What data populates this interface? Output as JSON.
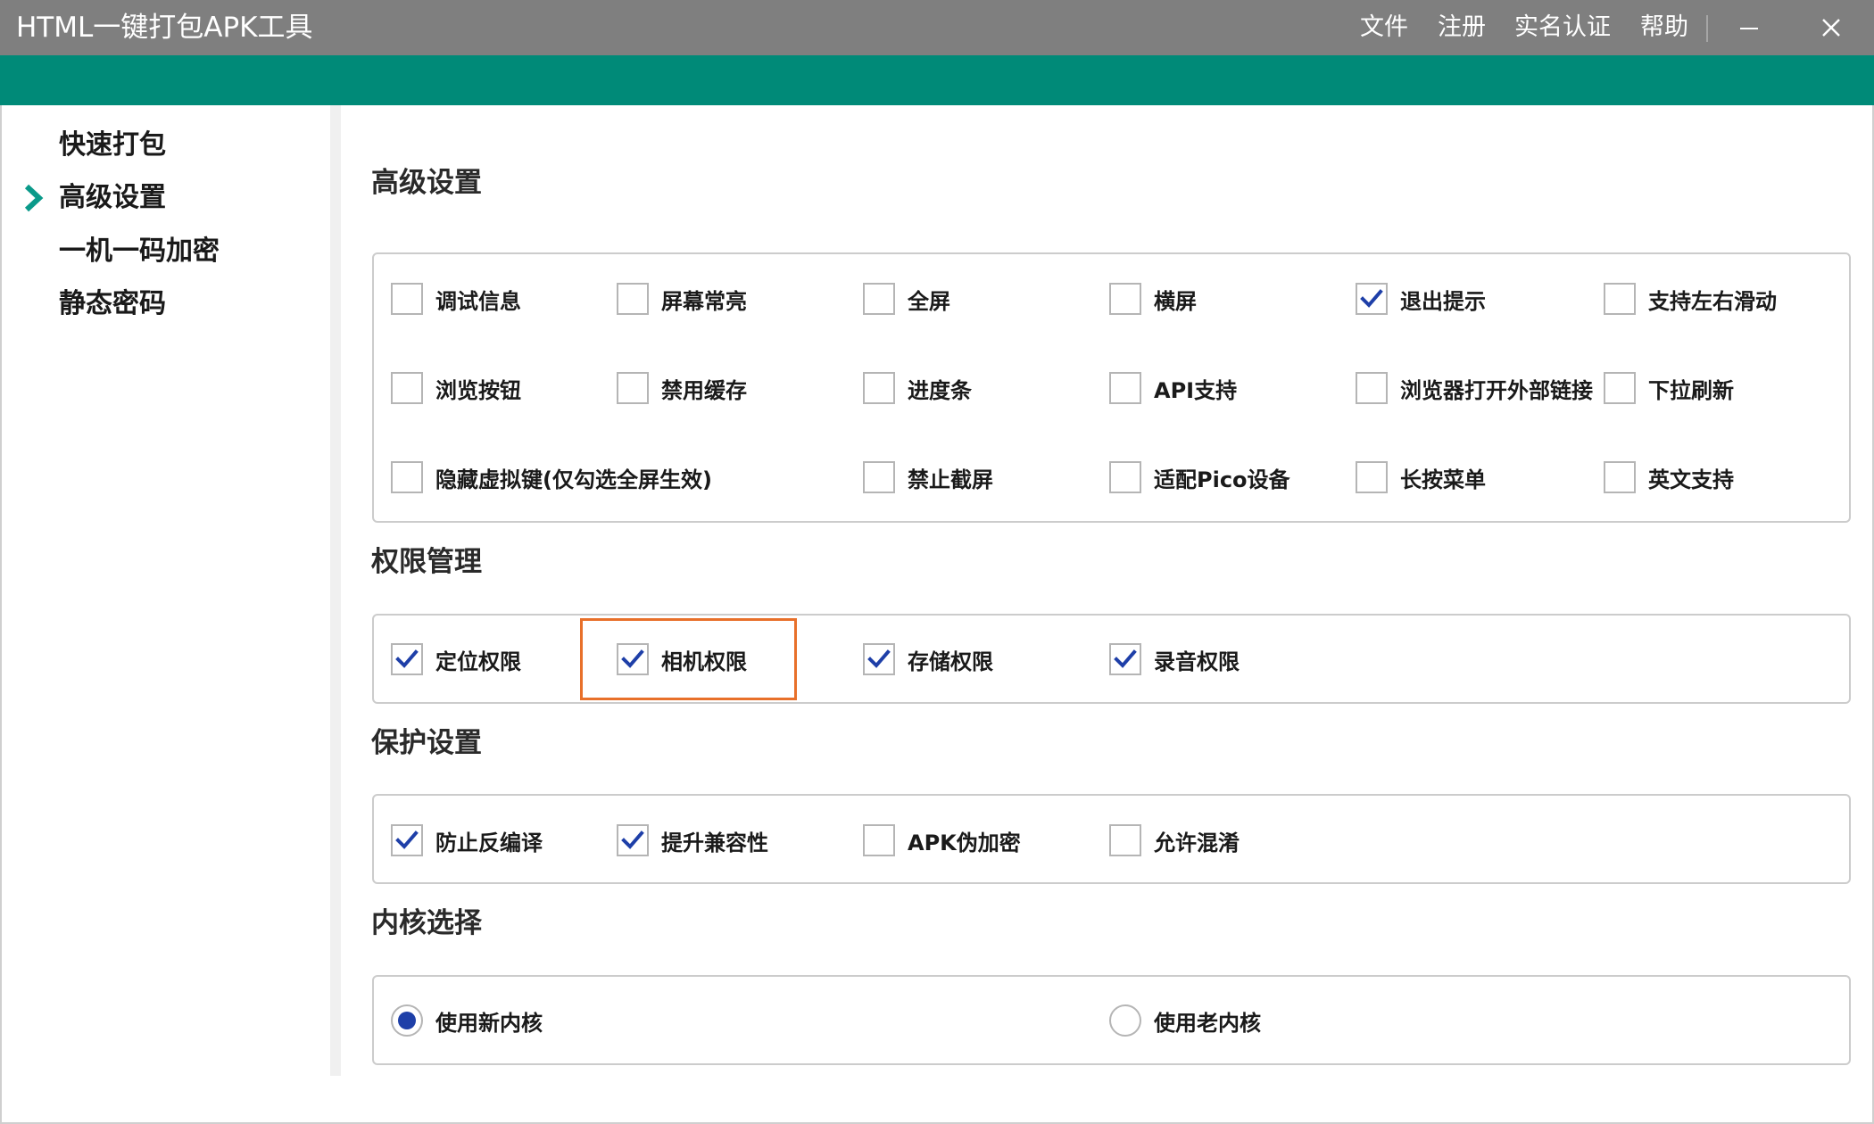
{
  "window": {
    "title": "HTML一键打包APK工具",
    "menu": [
      "文件",
      "注册",
      "实名认证",
      "帮助"
    ]
  },
  "sidebar": {
    "items": [
      {
        "label": "快速打包",
        "active": false
      },
      {
        "label": "高级设置",
        "active": true
      },
      {
        "label": "一机一码加密",
        "active": false
      },
      {
        "label": "静态密码",
        "active": false
      }
    ]
  },
  "advanced": {
    "title": "高级设置",
    "options": [
      {
        "label": "调试信息",
        "checked": false
      },
      {
        "label": "屏幕常亮",
        "checked": false
      },
      {
        "label": "全屏",
        "checked": false
      },
      {
        "label": "横屏",
        "checked": false
      },
      {
        "label": "退出提示",
        "checked": true
      },
      {
        "label": "支持左右滑动",
        "checked": false
      },
      {
        "label": "浏览按钮",
        "checked": false
      },
      {
        "label": "禁用缓存",
        "checked": false
      },
      {
        "label": "进度条",
        "checked": false
      },
      {
        "label": "API支持",
        "checked": false
      },
      {
        "label": "浏览器打开外部链接",
        "checked": false
      },
      {
        "label": "下拉刷新",
        "checked": false
      },
      {
        "label": "隐藏虚拟键(仅勾选全屏生效)",
        "checked": false
      },
      {
        "label": "禁止截屏",
        "checked": false
      },
      {
        "label": "适配Pico设备",
        "checked": false
      },
      {
        "label": "长按菜单",
        "checked": false
      },
      {
        "label": "英文支持",
        "checked": false
      }
    ]
  },
  "permissions": {
    "title": "权限管理",
    "options": [
      {
        "label": "定位权限",
        "checked": true
      },
      {
        "label": "相机权限",
        "checked": true
      },
      {
        "label": "存储权限",
        "checked": true
      },
      {
        "label": "录音权限",
        "checked": true
      }
    ]
  },
  "protection": {
    "title": "保护设置",
    "options": [
      {
        "label": "防止反编译",
        "checked": true
      },
      {
        "label": "提升兼容性",
        "checked": true
      },
      {
        "label": "APK伪加密",
        "checked": false
      },
      {
        "label": "允许混淆",
        "checked": false
      }
    ]
  },
  "kernel": {
    "title": "内核选择",
    "options": [
      {
        "label": "使用新内核",
        "selected": true
      },
      {
        "label": "使用老内核",
        "selected": false
      }
    ]
  },
  "colors": {
    "titlebar": "#7f7f7f",
    "accent_bar": "#008a78",
    "check_mark": "#1e3fa8",
    "highlight": "#e8702a",
    "nav_arrow": "#0a9a8a"
  }
}
